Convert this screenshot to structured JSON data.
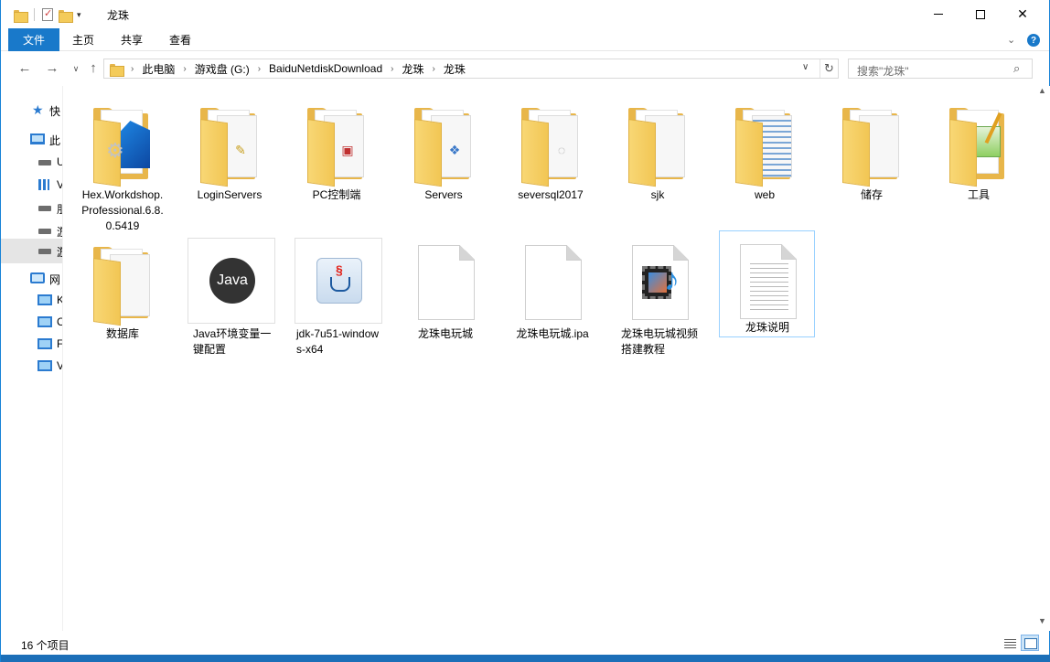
{
  "window": {
    "title": "龙珠"
  },
  "ribbon": {
    "tabs": [
      "文件",
      "主页",
      "共享",
      "查看"
    ]
  },
  "address": {
    "breadcrumbs": [
      "此电脑",
      "游戏盘 (G:)",
      "BaiduNetdiskDownload",
      "龙珠",
      "龙珠"
    ]
  },
  "search": {
    "placeholder": "搜索\"龙珠\""
  },
  "sidebar": {
    "items": [
      {
        "label": "快",
        "icon": "star-icon"
      },
      {
        "label": "此",
        "icon": "computer-icon"
      },
      {
        "label": "U",
        "icon": "drive-icon"
      },
      {
        "label": "V",
        "icon": "grid-icon"
      },
      {
        "label": "朋",
        "icon": "drive-icon"
      },
      {
        "label": "游",
        "icon": "drive-icon"
      },
      {
        "label": "游",
        "icon": "drive-icon"
      },
      {
        "label": "网",
        "icon": "network-icon"
      },
      {
        "label": "K",
        "icon": "monitor-icon"
      },
      {
        "label": "C",
        "icon": "monitor-icon"
      },
      {
        "label": "F",
        "icon": "monitor-icon"
      },
      {
        "label": "V",
        "icon": "monitor-icon"
      }
    ]
  },
  "files": [
    {
      "name": "Hex.Workdshop.Professional.6.8.0.5419",
      "type": "folder",
      "icon": "hex-workshop-icon"
    },
    {
      "name": "LoginServers",
      "type": "folder",
      "icon": "folder-icon"
    },
    {
      "name": "PC控制端",
      "type": "folder",
      "icon": "folder-icon"
    },
    {
      "name": "Servers",
      "type": "folder",
      "icon": "folder-icon"
    },
    {
      "name": "seversql2017",
      "type": "folder",
      "icon": "folder-icon"
    },
    {
      "name": "sjk",
      "type": "folder",
      "icon": "folder-icon"
    },
    {
      "name": "web",
      "type": "folder",
      "icon": "folder-icon"
    },
    {
      "name": "储存",
      "type": "folder",
      "icon": "folder-icon"
    },
    {
      "name": "工具",
      "type": "folder",
      "icon": "notepad-folder-icon"
    },
    {
      "name": "数据库",
      "type": "folder",
      "icon": "folder-icon"
    },
    {
      "name": "Java环境变量一键配置",
      "type": "file",
      "icon": "java-icon",
      "badge": "Java"
    },
    {
      "name": "jdk-7u51-windows-x64",
      "type": "file",
      "icon": "java-installer-icon"
    },
    {
      "name": "龙珠电玩城",
      "type": "file",
      "icon": "blank-file-icon"
    },
    {
      "name": "龙珠电玩城.ipa",
      "type": "file",
      "icon": "blank-file-icon"
    },
    {
      "name": "龙珠电玩城视频搭建教程",
      "type": "file",
      "icon": "video-file-icon"
    },
    {
      "name": "龙珠说明",
      "type": "file",
      "icon": "text-file-icon",
      "selected": true
    }
  ],
  "status": {
    "count_text": "16 个项目"
  },
  "colors": {
    "accent": "#1979ca",
    "folder": "#f4cb5a",
    "selection_border": "#99d1ff"
  }
}
